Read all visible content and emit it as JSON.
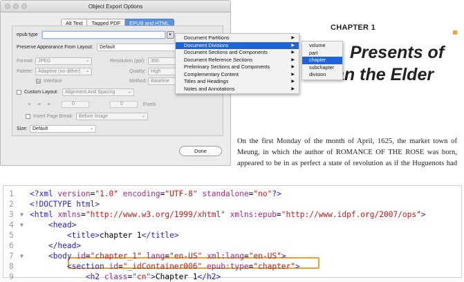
{
  "dialog": {
    "title": "Object Export Options",
    "tabs": [
      "Alt Text",
      "Tagged PDF",
      "EPUB and HTML"
    ],
    "epub_type_label": "epub:type",
    "epub_type_value": "",
    "arrow_glyph": "▸",
    "preserve_label": "Preserve Appearance From Layout:",
    "preserve_value": "Default",
    "format_label": "Format:",
    "format_value": "JPEG",
    "resolution_label": "Resolution (ppi):",
    "resolution_value": "300",
    "palette_label": "Palette:",
    "palette_value": "Adaptive (no dither)",
    "quality_label": "Quality:",
    "quality_value": "High",
    "interlace_label": "Interlace",
    "method_label": "Method:",
    "method_value": "Baseline",
    "custom_layout_label": "Custom Layout:",
    "custom_layout_value": "Alignment And Spacing",
    "spacing_value_1": "0",
    "spacing_value_2": "0",
    "pixels_label": "Pixels",
    "page_break_label": "Insert Page Break:",
    "page_break_value": "Before Image",
    "size_label": "Size:",
    "size_value": "Default",
    "done_label": "Done"
  },
  "main_menu": [
    {
      "label": "Document Partitions",
      "highlighted": false
    },
    {
      "label": "Document Divisions",
      "highlighted": true
    },
    {
      "label": "Document Sections and Components",
      "highlighted": false
    },
    {
      "label": "Document Reference Sections",
      "highlighted": false
    },
    {
      "label": "Preliminary Sections and Components",
      "highlighted": false
    },
    {
      "label": "Complementary Content",
      "highlighted": false
    },
    {
      "label": "Titles and Headings",
      "highlighted": false
    },
    {
      "label": "Notes and Annotations",
      "highlighted": false
    }
  ],
  "submenu_glyph": "▶",
  "sub_menu": [
    {
      "label": "volume",
      "highlighted": false
    },
    {
      "label": "part",
      "highlighted": false
    },
    {
      "label": "chapter",
      "highlighted": true
    },
    {
      "label": "subchapter",
      "highlighted": false
    },
    {
      "label": "division",
      "highlighted": false
    }
  ],
  "book": {
    "chapter_label": "CHAPTER 1",
    "title_line1": "Presents of",
    "title_line2": "an the Elder",
    "body": "On the first Monday of the month of April, 1625, the market town of Meung, in which the author of ROMANCE OF THE ROSE was born, appeared to be in as perfect a state of revolution as if the Huguenots had just made a second"
  },
  "colors": {
    "accent": "#f0a235",
    "menu_highlight": "#1f64d8",
    "tab_active": "#5b8fe0",
    "code_tag": "#2a21c9",
    "code_attr": "#a4278d",
    "code_value": "#c41a16",
    "code_highlight_box": "#f29d2e"
  },
  "code": {
    "lines": [
      {
        "n": "1",
        "fold": "",
        "tokens": [
          [
            "tag",
            "<?xml "
          ],
          [
            "attr",
            "version"
          ],
          [
            "txt",
            "="
          ],
          [
            "val",
            "\"1.0\""
          ],
          [
            "txt",
            " "
          ],
          [
            "attr",
            "encoding"
          ],
          [
            "txt",
            "="
          ],
          [
            "val",
            "\"UTF-8\""
          ],
          [
            "txt",
            " "
          ],
          [
            "attr",
            "standalone"
          ],
          [
            "txt",
            "="
          ],
          [
            "val",
            "\"no\""
          ],
          [
            "tag",
            "?>"
          ]
        ]
      },
      {
        "n": "2",
        "fold": "",
        "tokens": [
          [
            "tag",
            "<!DOCTYPE html>"
          ]
        ]
      },
      {
        "n": "3",
        "fold": "▼",
        "tokens": [
          [
            "tag",
            "<html "
          ],
          [
            "attr",
            "xmlns"
          ],
          [
            "txt",
            "="
          ],
          [
            "val",
            "\"http://www.w3.org/1999/xhtml\""
          ],
          [
            "txt",
            " "
          ],
          [
            "attr",
            "xmlns:epub"
          ],
          [
            "txt",
            "="
          ],
          [
            "val",
            "\"http://www.idpf.org/2007/ops\""
          ],
          [
            "tag",
            ">"
          ]
        ]
      },
      {
        "n": "4",
        "fold": "▼",
        "tokens": [
          [
            "txt",
            "    "
          ],
          [
            "tag",
            "<head>"
          ]
        ]
      },
      {
        "n": "5",
        "fold": "",
        "tokens": [
          [
            "txt",
            "        "
          ],
          [
            "tag",
            "<title>"
          ],
          [
            "txt",
            "chapter 1"
          ],
          [
            "tag",
            "</title>"
          ]
        ]
      },
      {
        "n": "6",
        "fold": "",
        "tokens": [
          [
            "txt",
            "    "
          ],
          [
            "tag",
            "</head>"
          ]
        ]
      },
      {
        "n": "7",
        "fold": "▼",
        "tokens": [
          [
            "txt",
            "    "
          ],
          [
            "tag",
            "<body "
          ],
          [
            "attr",
            "id"
          ],
          [
            "txt",
            "="
          ],
          [
            "val",
            "\"chapter_1\""
          ],
          [
            "txt",
            " "
          ],
          [
            "attr",
            "lang"
          ],
          [
            "txt",
            "="
          ],
          [
            "val",
            "\"en-US\""
          ],
          [
            "txt",
            " "
          ],
          [
            "attr",
            "xml:lang"
          ],
          [
            "txt",
            "="
          ],
          [
            "val",
            "\"en-US\""
          ],
          [
            "tag",
            ">"
          ]
        ]
      },
      {
        "n": "8",
        "fold": "",
        "tokens": [
          [
            "txt",
            "        "
          ],
          [
            "tag",
            "<section "
          ],
          [
            "attr",
            "id"
          ],
          [
            "txt",
            "="
          ],
          [
            "val",
            "\"_idContainer006\""
          ],
          [
            "txt",
            " "
          ],
          [
            "attr",
            "epub:type"
          ],
          [
            "txt",
            "="
          ],
          [
            "val",
            "\"chapter\""
          ],
          [
            "tag",
            ">"
          ]
        ]
      },
      {
        "n": "9",
        "fold": "",
        "tokens": [
          [
            "txt",
            "            "
          ],
          [
            "tag",
            "<h2 "
          ],
          [
            "attr",
            "class"
          ],
          [
            "txt",
            "="
          ],
          [
            "val",
            "\"cn\""
          ],
          [
            "tag",
            ">"
          ],
          [
            "txt",
            "Chapter 1"
          ],
          [
            "tag",
            "</h2>"
          ]
        ]
      }
    ]
  }
}
